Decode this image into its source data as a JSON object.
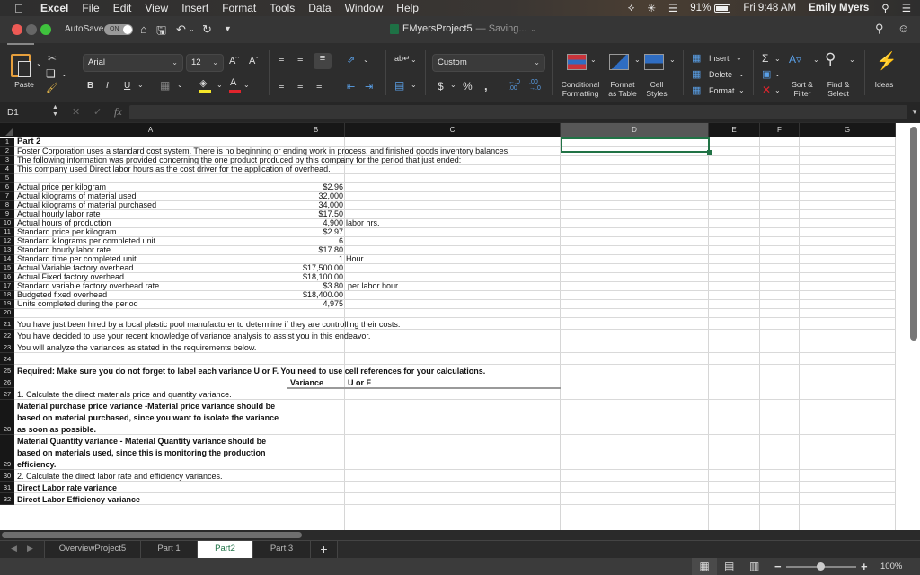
{
  "menubar": {
    "app": "Excel",
    "items": [
      "File",
      "Edit",
      "View",
      "Insert",
      "Format",
      "Tools",
      "Data",
      "Window",
      "Help"
    ],
    "battery": "91%",
    "clock": "Fri 9:48 AM",
    "user": "Emily Myers"
  },
  "titlebar": {
    "autosave_label": "AutoSave",
    "autosave_state": "ON",
    "document": "EMyersProject5",
    "status": "— Saving..."
  },
  "ribbon": {
    "paste": "Paste",
    "font_name": "Arial",
    "font_size": "12",
    "number_format": "Custom",
    "conditional_formatting": [
      "Conditional",
      "Formatting"
    ],
    "format_as_table": [
      "Format",
      "as Table"
    ],
    "cell_styles": [
      "Cell",
      "Styles"
    ],
    "insert": "Insert",
    "delete": "Delete",
    "format": "Format",
    "sort_filter": [
      "Sort &",
      "Filter"
    ],
    "find_select": [
      "Find &",
      "Select"
    ],
    "ideas": "Ideas",
    "colors": {
      "fill": "#f5e629",
      "font": "#e0242c",
      "accent": "#217346"
    }
  },
  "formula_bar": {
    "name_box": "D1",
    "fx": "fx",
    "value": ""
  },
  "columns": [
    "A",
    "B",
    "C",
    "D",
    "E",
    "F",
    "G"
  ],
  "selected_cell": "D1",
  "rows": [
    {
      "n": "1",
      "A": "Part 2",
      "bold": true
    },
    {
      "n": "2",
      "A": "Foster Corporation uses a standard cost system. There is no beginning or ending work in process, and finished goods inventory balances."
    },
    {
      "n": "3",
      "A": "The following information was provided concerning the one product produced by this company for the period that just ended:"
    },
    {
      "n": "4",
      "A": "This company used Direct labor hours as the cost driver for the application of overhead."
    },
    {
      "n": "5"
    },
    {
      "n": "6",
      "A": "Actual price per kilogram",
      "B": "$2.96"
    },
    {
      "n": "7",
      "A": "Actual kilograms of material used",
      "B": "32,000"
    },
    {
      "n": "8",
      "A": "Actual kilograms of material purchased",
      "B": "34,000"
    },
    {
      "n": "9",
      "A": "Actual hourly labor rate",
      "B": "$17.50"
    },
    {
      "n": "10",
      "A": "Actual hours of production",
      "B": "4,900",
      "C": "labor hrs."
    },
    {
      "n": "11",
      "A": "Standard price per kilogram",
      "B": "$2.97"
    },
    {
      "n": "12",
      "A": "Standard kilograms per completed unit",
      "B": "6"
    },
    {
      "n": "13",
      "A": "Standard hourly labor rate",
      "B": "$17.80"
    },
    {
      "n": "14",
      "A": "Standard time per completed unit",
      "B": "1",
      "C": "Hour"
    },
    {
      "n": "15",
      "A": "Actual Variable factory overhead",
      "B": "$17,500.00"
    },
    {
      "n": "16",
      "A": "Actual Fixed factory overhead",
      "B": "$18,100.00"
    },
    {
      "n": "17",
      "A": "Standard variable factory overhead rate",
      "B": "$3.80",
      "C": "per labor hour"
    },
    {
      "n": "18",
      "A": "Budgeted fixed overhead",
      "B": "$18,400.00"
    },
    {
      "n": "19",
      "A": "Units completed during the period",
      "B": "4,975"
    },
    {
      "n": "20"
    },
    {
      "n": "21",
      "A": "You have just been hired by a local plastic pool manufacturer to determine if they are controlling their costs."
    },
    {
      "n": "22",
      "A": "You have decided to use your recent knowledge of variance analysis to assist you in this endeavor."
    },
    {
      "n": "23",
      "A": "You will analyze the variances as stated in the requirements below."
    },
    {
      "n": "24"
    },
    {
      "n": "25",
      "A": "Required:  Make sure you do not forget to label each variance U or F.  You need to use cell references for your calculations.",
      "bold": true
    },
    {
      "n": "26",
      "B": "Variance",
      "C": "U or F",
      "bold": true
    },
    {
      "n": "27",
      "A": "1.  Calculate the direct materials price and quantity variance."
    },
    {
      "n": "28",
      "A": "Material purchase price variance -Material price variance should be based on material purchased, since you want to isolate the variance as soon as possible.",
      "bold": true
    },
    {
      "n": "29",
      "A": "Material Quantity variance - Material Quantity variance should be based on materials used, since this is monitoring the production efficiency.",
      "bold": true
    },
    {
      "n": "30",
      "A": "2.  Calculate the direct labor rate and efficiency variances."
    },
    {
      "n": "31",
      "A": "Direct Labor rate variance",
      "bold": true
    },
    {
      "n": "32",
      "A": "Direct Labor Efficiency variance",
      "bold": true
    }
  ],
  "sheet_tabs": [
    "OverviewProject5",
    "Part 1",
    "Part2",
    "Part 3"
  ],
  "active_tab": "Part2",
  "zoom": "100%"
}
